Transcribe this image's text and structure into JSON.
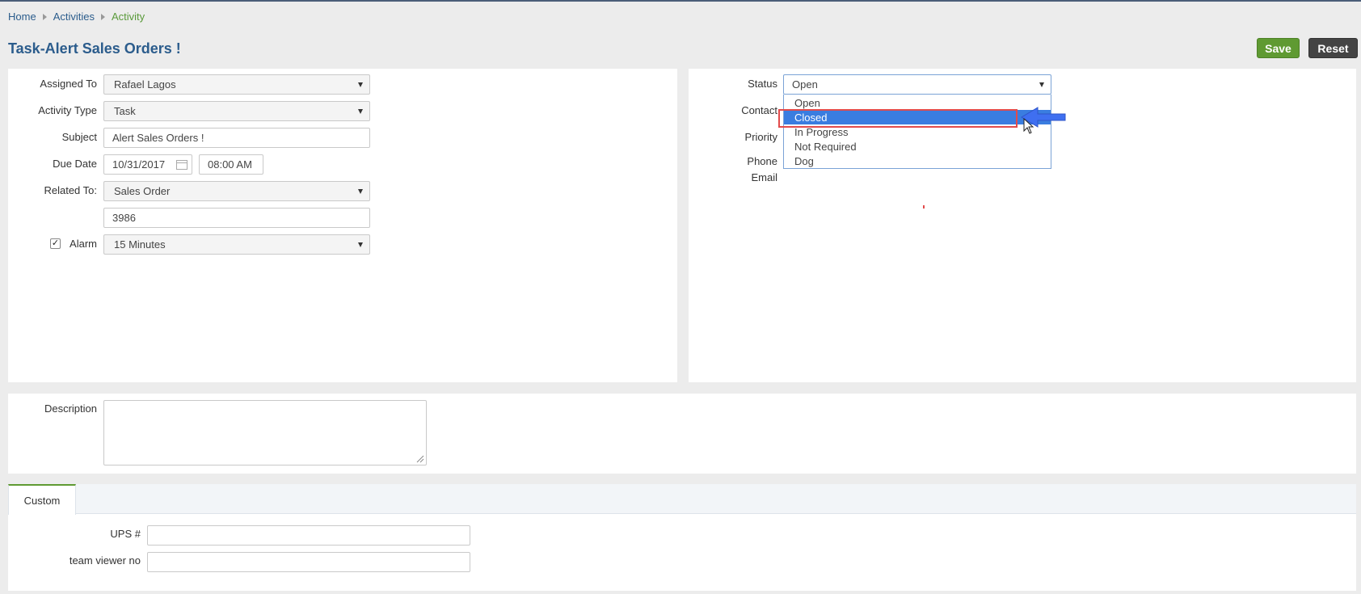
{
  "breadcrumb": {
    "home": "Home",
    "activities": "Activities",
    "current": "Activity"
  },
  "page_title": "Task-Alert Sales Orders !",
  "buttons": {
    "save": "Save",
    "reset": "Reset"
  },
  "form": {
    "assigned_to": {
      "label": "Assigned To",
      "value": "Rafael Lagos"
    },
    "activity_type": {
      "label": "Activity Type",
      "value": "Task"
    },
    "subject": {
      "label": "Subject",
      "value": "Alert Sales Orders !"
    },
    "due_date": {
      "label": "Due Date",
      "date": "10/31/2017",
      "time": "08:00 AM"
    },
    "related_to": {
      "label": "Related To:",
      "value": "Sales Order",
      "id_value": "3986"
    },
    "alarm": {
      "label": "Alarm",
      "checked": true,
      "value": "15 Minutes"
    }
  },
  "right": {
    "status": {
      "label": "Status",
      "value": "Open"
    },
    "contact_label": "Contact",
    "priority_label": "Priority",
    "phone_label": "Phone",
    "email_label": "Email"
  },
  "status_dropdown": {
    "options": [
      "Open",
      "Closed",
      "In Progress",
      "Not Required",
      "Dog"
    ],
    "highlighted": "Closed"
  },
  "description": {
    "label": "Description",
    "value": ""
  },
  "tabs": [
    {
      "label": "Custom",
      "active": true
    }
  ],
  "custom": {
    "ups": {
      "label": "UPS #",
      "value": ""
    },
    "team_viewer": {
      "label": "team viewer no",
      "value": ""
    }
  },
  "colors": {
    "accent_green": "#5f9a32",
    "link_blue": "#2b5c8c",
    "select_blue": "#3a7de0",
    "arrow_blue": "#3f6ff0",
    "highlight_red": "#e24b4b"
  }
}
